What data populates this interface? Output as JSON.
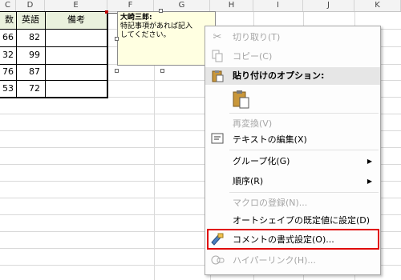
{
  "columns": {
    "C": "C",
    "D": "D",
    "E": "E",
    "F": "F",
    "G": "G",
    "H": "H",
    "I": "I",
    "J": "J",
    "K": "K"
  },
  "table": {
    "headers": [
      "数",
      "英語",
      "備考"
    ],
    "rows": [
      [
        "66",
        "82",
        ""
      ],
      [
        "32",
        "99",
        ""
      ],
      [
        "76",
        "87",
        ""
      ],
      [
        "53",
        "72",
        ""
      ]
    ]
  },
  "comment": {
    "author": "大崎三郎:",
    "line1": "特記事項があれば記入",
    "line2": "してください。"
  },
  "menu": {
    "cut": "切り取り(T)",
    "copy": "コピー(C)",
    "paste_options": "貼り付けのオプション:",
    "reconvert": "再変換(V)",
    "edit_text": "テキストの編集(X)",
    "group": "グループ化(G)",
    "order": "順序(R)",
    "assign_macro": "マクロの登録(N)...",
    "set_default": "オートシェイプの既定値に設定(D)",
    "format_comment": "コメントの書式設定(O)...",
    "hyperlink": "ハイパーリンク(H)..."
  },
  "colors": {
    "highlight_border": "#e00000",
    "header_fill": "#eaf1dd",
    "comment_fill": "#ffffe1"
  }
}
